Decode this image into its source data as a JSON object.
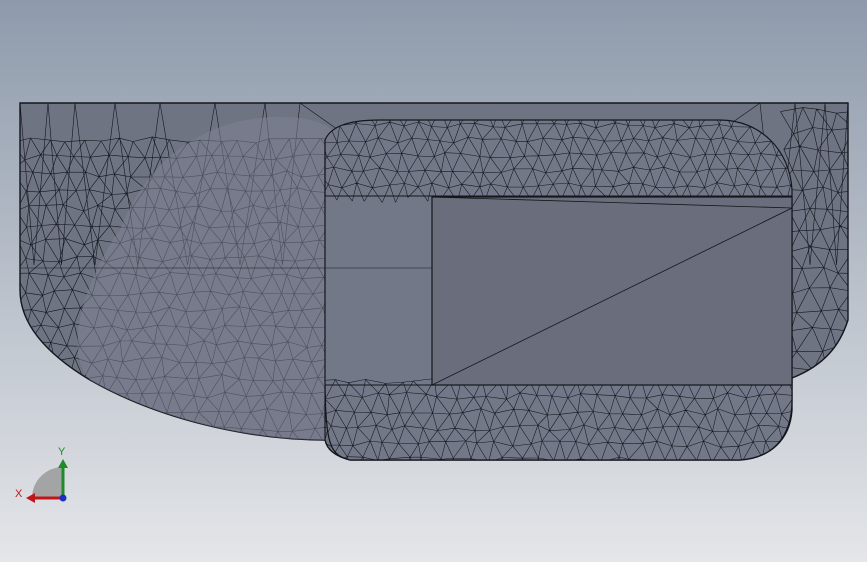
{
  "colors": {
    "background_top": "#8e9aab",
    "background_bottom": "#e4e6e9",
    "mesh_fill": "#6f7483",
    "mesh_fill_light": "#7d8293",
    "mesh_face_flat": "#6a6d7b",
    "mesh_lines": "#14161c",
    "x_axis": "#c0161b",
    "y_axis": "#1e8a2a",
    "z_axis": "#1c2fc4",
    "triad_plane": "#9a9a9a"
  },
  "triad": {
    "x_label": "X",
    "y_label": "Y",
    "z_icon": "z-axis-dot-icon"
  }
}
